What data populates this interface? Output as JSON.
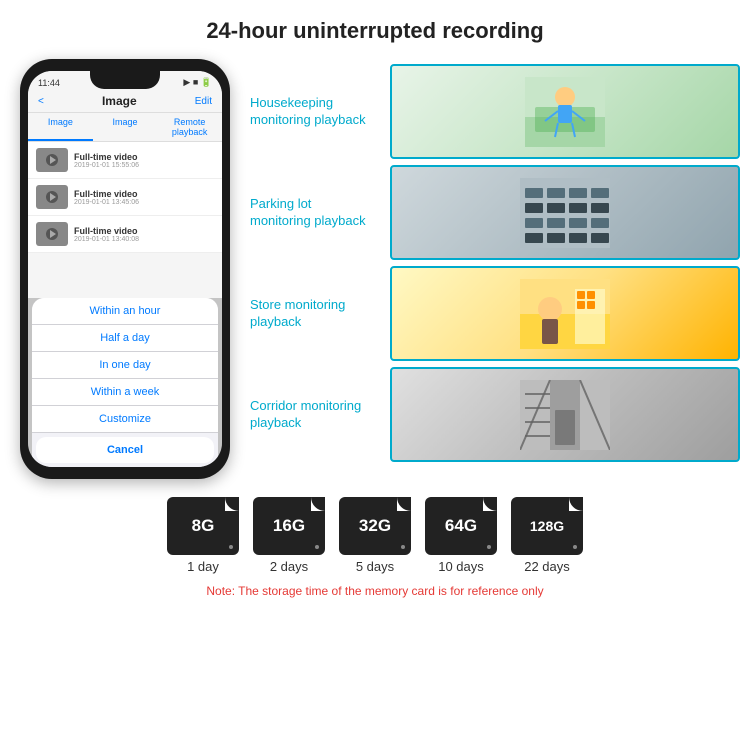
{
  "header": {
    "title": "24-hour uninterrupted recording"
  },
  "phone": {
    "status_time": "11:44",
    "screen_title": "Image",
    "back_label": "<",
    "edit_label": "Edit",
    "tabs": [
      "Image",
      "Image",
      "Remote playback"
    ],
    "list_items": [
      {
        "title": "Full-time video",
        "date": "2019-01-01 15:55:06"
      },
      {
        "title": "Full-time video",
        "date": "2019-01-01 13:45:06"
      },
      {
        "title": "Full-time video",
        "date": "2019-01-01 13:40:08"
      }
    ],
    "dropdown": {
      "items": [
        "Within an hour",
        "Half a day",
        "In one day",
        "Within a week",
        "Customize"
      ],
      "cancel_label": "Cancel"
    }
  },
  "monitoring": [
    {
      "label": "Housekeeping\nmonitoring playback",
      "photo_type": "photo-child"
    },
    {
      "label": "Parking lot\nmonitoring playback",
      "photo_type": "photo-parking"
    },
    {
      "label": "Store monitoring\nplayback",
      "photo_type": "photo-store"
    },
    {
      "label": "Corridor monitoring\nplayback",
      "photo_type": "photo-corridor"
    }
  ],
  "sdcards": [
    {
      "capacity": "8G",
      "days": "1 day"
    },
    {
      "capacity": "16G",
      "days": "2 days"
    },
    {
      "capacity": "32G",
      "days": "5 days"
    },
    {
      "capacity": "64G",
      "days": "10 days"
    },
    {
      "capacity": "128G",
      "days": "22 days"
    }
  ],
  "note": {
    "text": "Note: The storage time of the memory card is for reference only"
  },
  "colors": {
    "accent": "#00aacc",
    "note_color": "#e53935",
    "phone_bg": "#1a1a1a"
  }
}
